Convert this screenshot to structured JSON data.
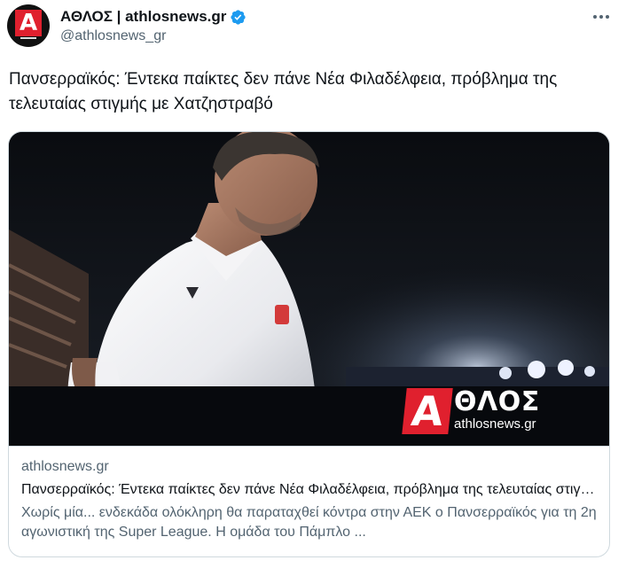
{
  "author": {
    "display_name": "ΑΘΛΟΣ | athlosnews.gr",
    "handle": "@athlosnews_gr",
    "verified": true,
    "avatar_letter": "Α"
  },
  "tweet": {
    "text": "Πανσερραϊκός: Έντεκα παίκτες δεν πάνε Νέα Φιλαδέλφεια, πρόβλημα της τελευταίας στιγμής με Χατζηστραβό"
  },
  "card": {
    "logo_letter": "Α",
    "logo_brand": "ΘΛΟΣ",
    "logo_site": "athlosnews.gr",
    "domain": "athlosnews.gr",
    "title": "Πανσερραϊκός: Έντεκα παίκτες δεν πάνε Νέα Φιλαδέλφεια, πρόβλημα της τελευταίας στιγμής με Χατζηστραβό",
    "description": "Χωρίς μία... ενδεκάδα ολόκληρη θα παραταχθεί κόντρα στην ΑΕΚ ο Πανσερραϊκός για τη 2η αγωνιστική της Super League. Η ομάδα του Πάμπλο ..."
  },
  "colors": {
    "brand_red": "#e0202e",
    "verified_blue": "#1d9bf0",
    "secondary_text": "#536471",
    "border": "#cfd9de"
  },
  "icons": {
    "verified": "verified-badge-icon",
    "more": "more-options-icon"
  }
}
